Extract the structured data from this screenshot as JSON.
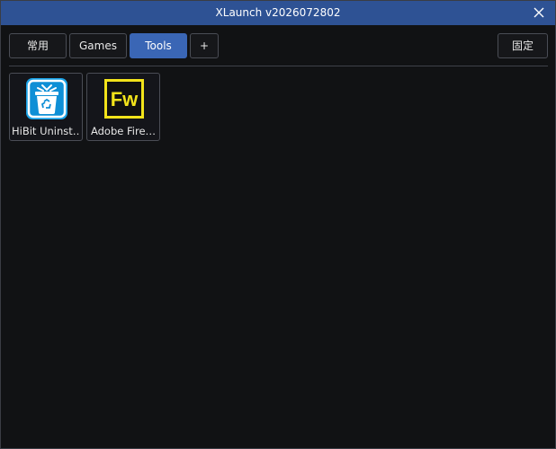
{
  "window": {
    "title": "XLaunch v2026072802",
    "close_glyph": "✕"
  },
  "tabs": [
    {
      "label": "常用",
      "active": false
    },
    {
      "label": "Games",
      "active": false
    },
    {
      "label": "Tools",
      "active": true
    },
    {
      "label": "+",
      "active": false
    }
  ],
  "pin_button": {
    "label": "固定"
  },
  "apps": [
    {
      "label": "HiBit Uninst…",
      "icon": "recycle-bin-icon",
      "accent": "#1aa3e8"
    },
    {
      "label": "Adobe Fire…",
      "icon": "fireworks-fw-icon",
      "icon_text": "Fw",
      "accent": "#f2e31a"
    }
  ],
  "colors": {
    "titlebar": "#2e5294",
    "background": "#111214",
    "active_tab": "#3a66b5",
    "border": "#4a4d55"
  }
}
